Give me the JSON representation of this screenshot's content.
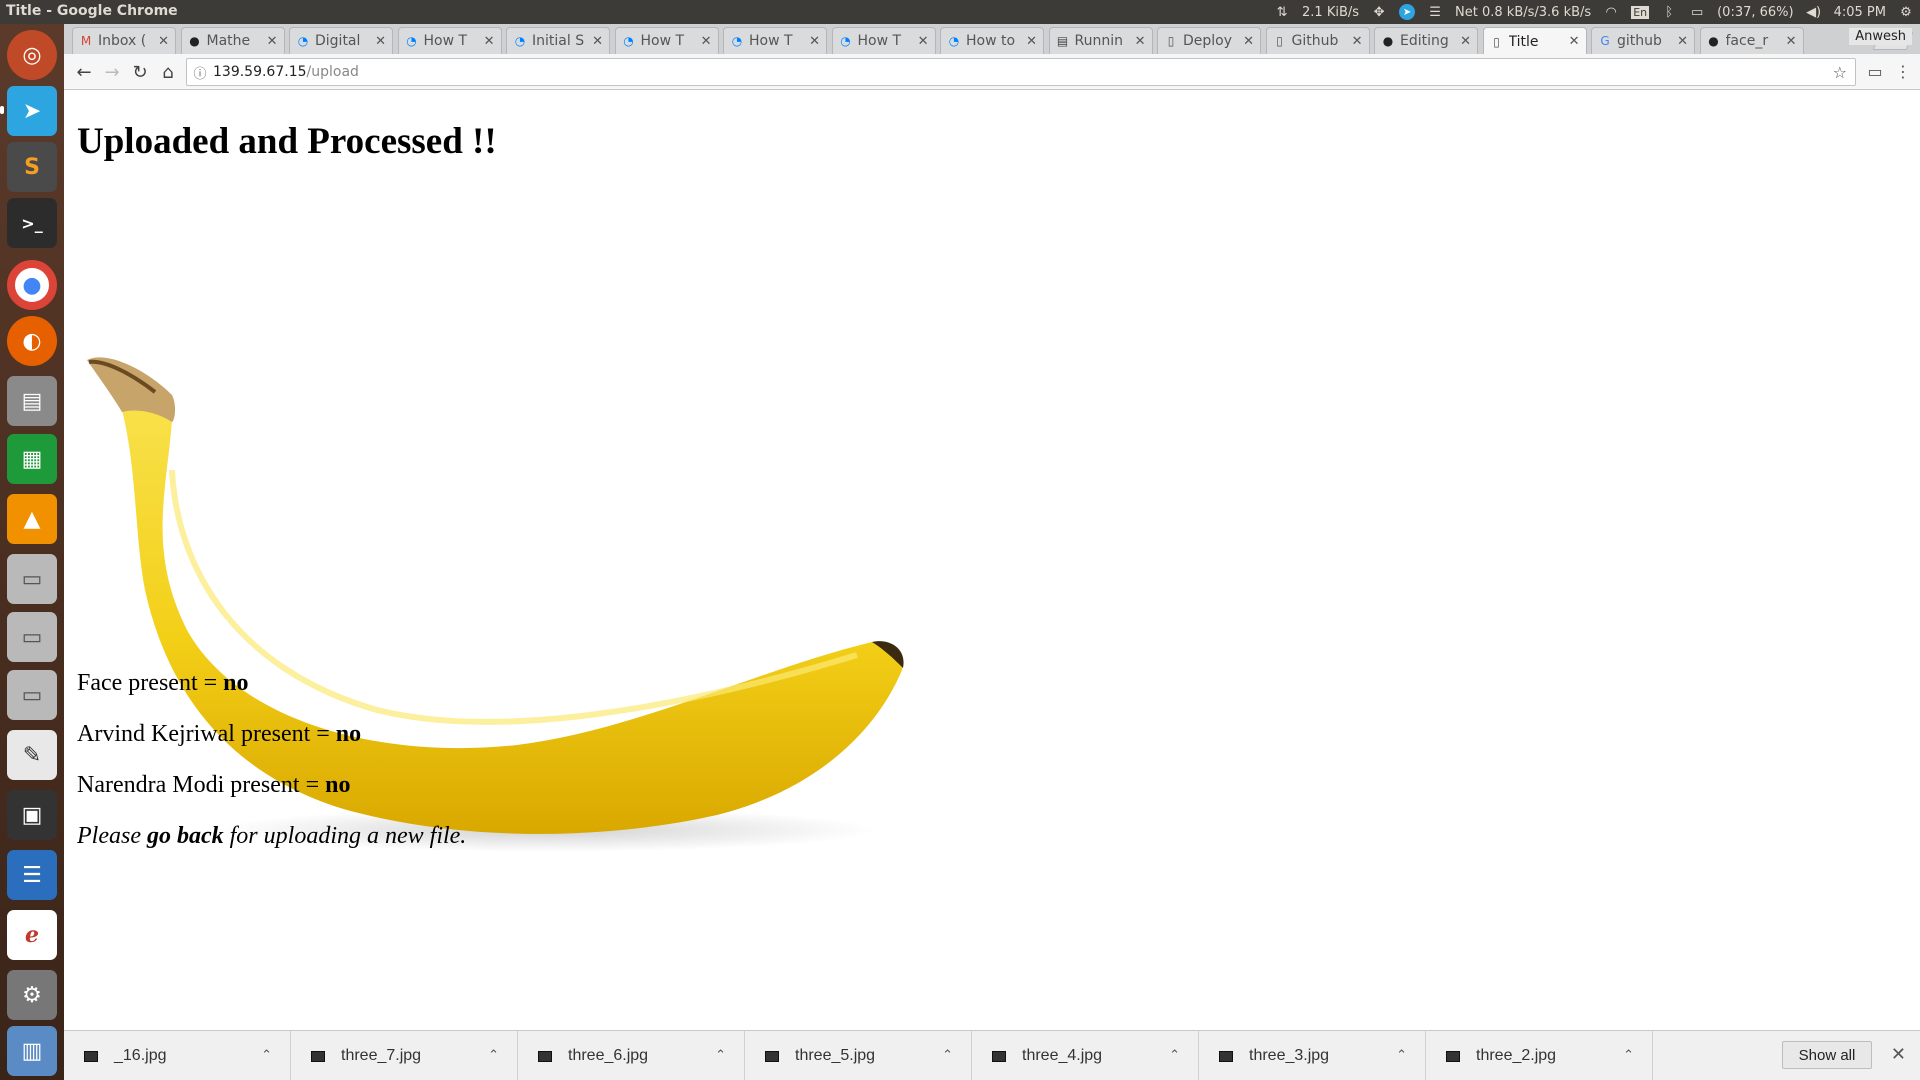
{
  "window": {
    "title": "Title - Google Chrome"
  },
  "panel": {
    "net_speed": "2.1 KiB/s",
    "net_stats": "Net 0.8 kB/s/3.6 kB/s",
    "keyboard": "En",
    "battery": "(0:37, 66%)",
    "clock": "4:05 PM"
  },
  "tabs": [
    {
      "label": "Inbox (",
      "icon": "gmail-icon"
    },
    {
      "label": "Mathe",
      "icon": "github-icon"
    },
    {
      "label": "Digital",
      "icon": "digitalocean-icon"
    },
    {
      "label": "How T",
      "icon": "digitalocean-icon"
    },
    {
      "label": "Initial S",
      "icon": "digitalocean-icon"
    },
    {
      "label": "How T",
      "icon": "digitalocean-icon"
    },
    {
      "label": "How T",
      "icon": "digitalocean-icon"
    },
    {
      "label": "How T",
      "icon": "digitalocean-icon"
    },
    {
      "label": "How to",
      "icon": "digitalocean-icon"
    },
    {
      "label": "Runnin",
      "icon": "doc-icon"
    },
    {
      "label": "Deploy",
      "icon": "page-icon"
    },
    {
      "label": "Github",
      "icon": "page-icon"
    },
    {
      "label": "Editing",
      "icon": "github-icon"
    },
    {
      "label": "Title",
      "icon": "page-icon",
      "active": true
    },
    {
      "label": "github",
      "icon": "google-icon"
    },
    {
      "label": "face_r",
      "icon": "github-icon"
    }
  ],
  "profile": {
    "name": "Anwesh"
  },
  "address": {
    "host": "139.59.67.15",
    "path": "/upload"
  },
  "page": {
    "heading": "Uploaded and Processed !!",
    "image_alt": "banana",
    "results": [
      {
        "label": "Face present = ",
        "value": "no"
      },
      {
        "label": "Arvind Kejriwal present = ",
        "value": "no"
      },
      {
        "label": "Narendra Modi present = ",
        "value": "no"
      }
    ],
    "footer": {
      "before": "Please ",
      "link": "go back",
      "after": " for uploading a new file."
    }
  },
  "downloads": {
    "items": [
      "_16.jpg",
      "three_7.jpg",
      "three_6.jpg",
      "three_5.jpg",
      "three_4.jpg",
      "three_3.jpg",
      "three_2.jpg"
    ],
    "show_all": "Show all"
  },
  "colors": {
    "panel_bg": "#3c3b37",
    "launcher_bg": "#4a2e20",
    "banana_yellow": "#f5d21a"
  }
}
